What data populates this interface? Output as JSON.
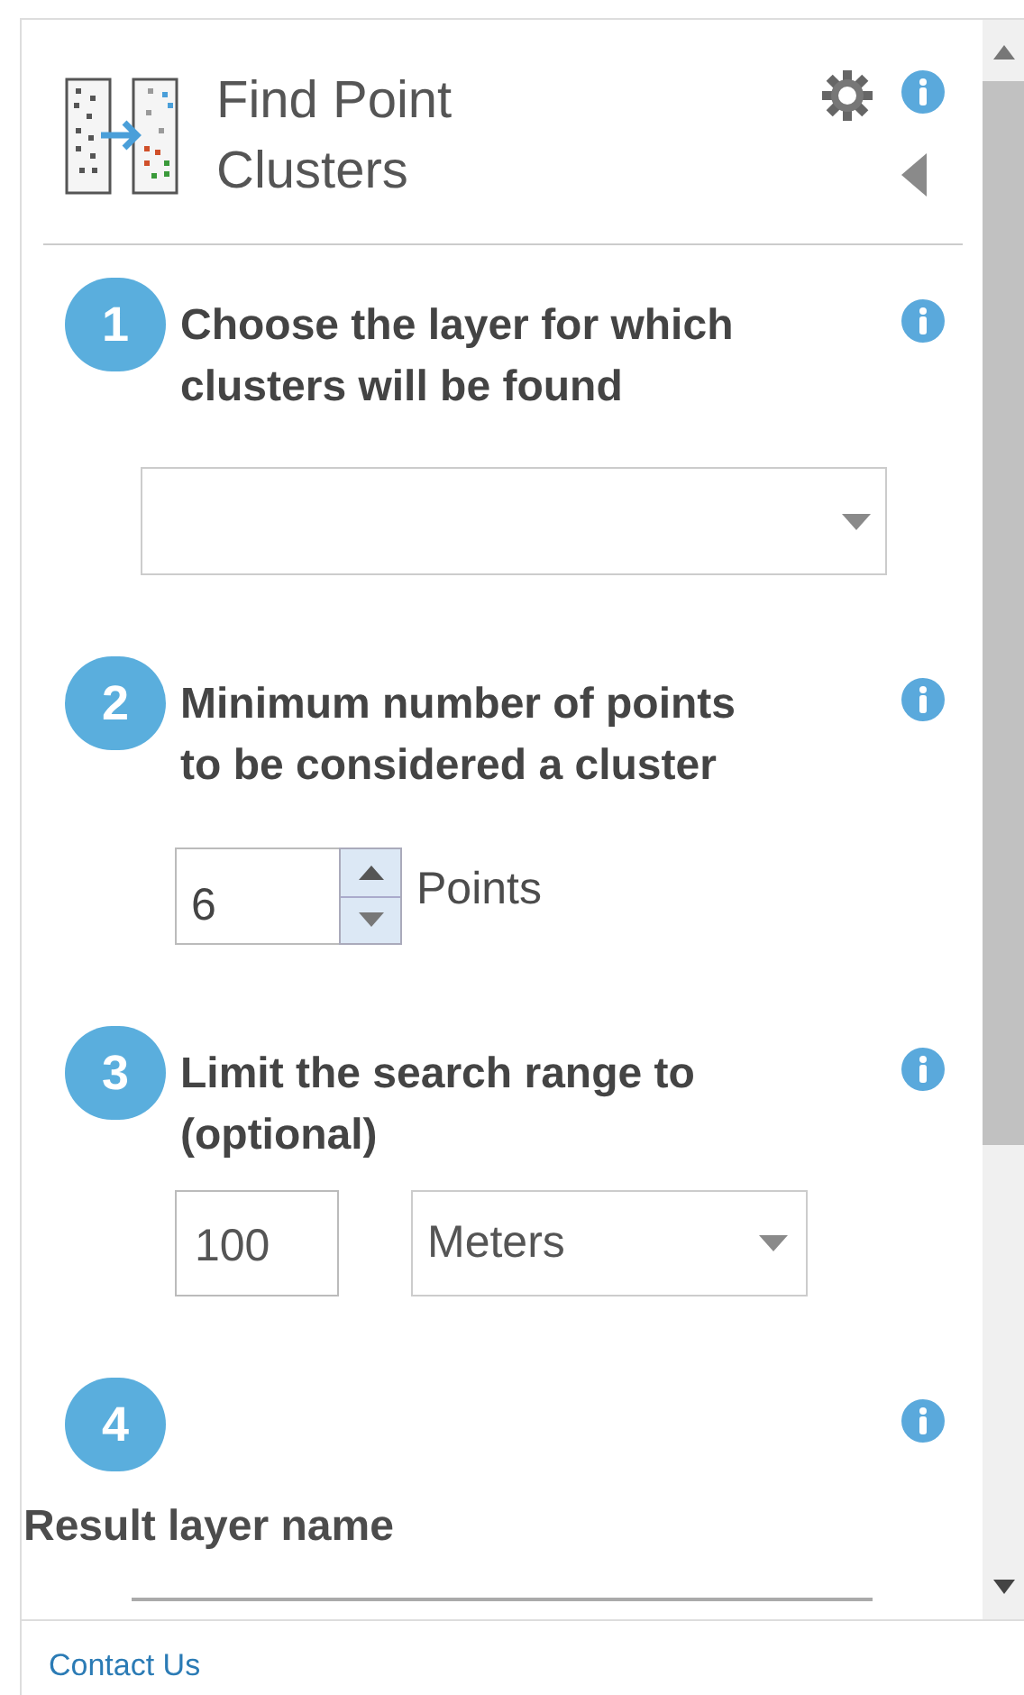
{
  "panel": {
    "title": "Find Point Clusters"
  },
  "steps": [
    {
      "number": "1",
      "kind": "dropdown",
      "title": "Choose the layer for which clusters will be found"
    },
    {
      "number": "2",
      "kind": "spinner",
      "title": "Minimum number of points to be considered a cluster",
      "value": "6",
      "unit": "Points"
    },
    {
      "number": "3",
      "kind": "distance",
      "title": "Limit the search range to (optional)",
      "value": "100",
      "unit": "Meters"
    },
    {
      "number": "4",
      "kind": "text_field",
      "label": "Result layer name"
    }
  ],
  "footer": {
    "link": "Contact Us"
  }
}
